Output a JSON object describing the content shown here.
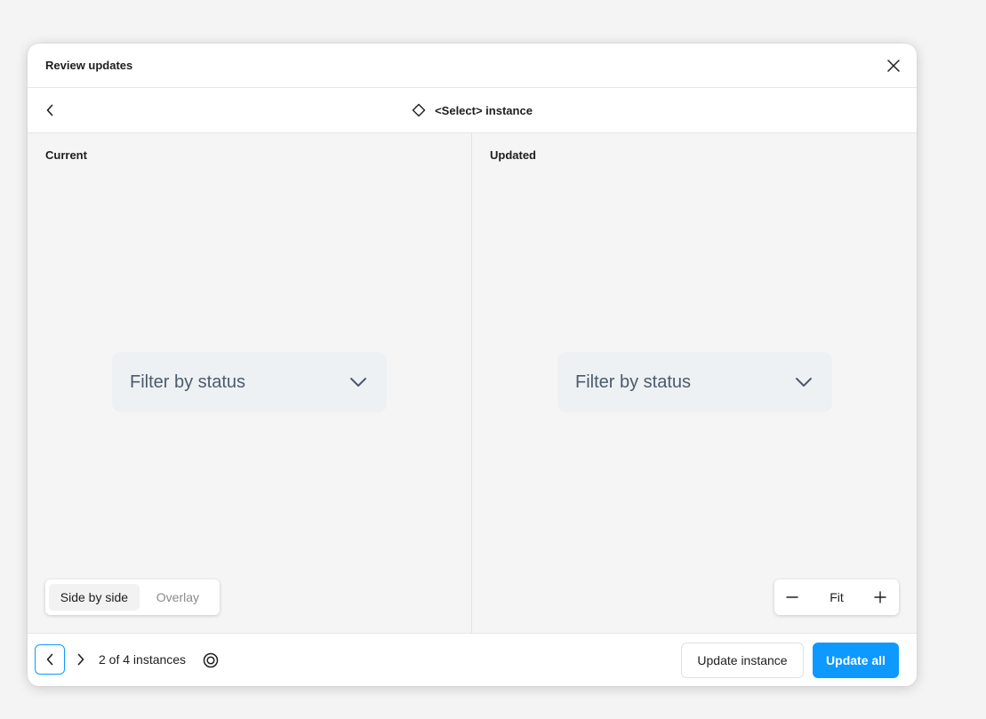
{
  "dialog": {
    "title": "Review updates",
    "instance_title": "<Select> instance"
  },
  "panels": {
    "current": {
      "label": "Current",
      "preview_text": "Filter by status"
    },
    "updated": {
      "label": "Updated",
      "preview_text": "Filter by status"
    }
  },
  "view_toggle": {
    "options": [
      "Side by side",
      "Overlay"
    ],
    "selected": "Side by side"
  },
  "zoom": {
    "label": "Fit"
  },
  "footer": {
    "counter": "2 of 4 instances",
    "update_instance_label": "Update instance",
    "update_all_label": "Update all"
  },
  "icons": {
    "close": "close-icon",
    "back": "chevron-left-icon",
    "component": "diamond-icon",
    "dropdown": "chevron-down-icon",
    "minus": "minus-icon",
    "plus": "plus-icon",
    "prev": "chevron-left-icon",
    "next": "chevron-right-icon",
    "target": "target-icon"
  },
  "colors": {
    "accent": "#0d99ff",
    "panel_bg": "#f5f5f5",
    "preview_bg": "#eef1f4",
    "preview_text": "#4b5a6c"
  }
}
